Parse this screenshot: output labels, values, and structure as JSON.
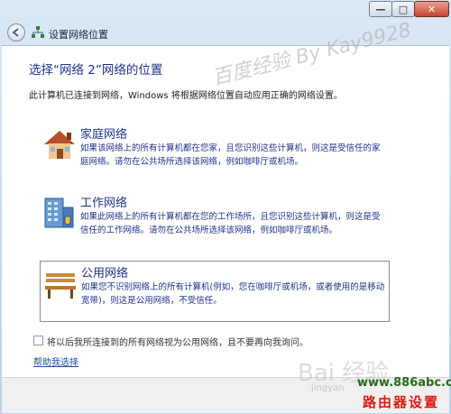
{
  "titlebar": {
    "minimize_glyph": "—",
    "maximize_glyph": "□",
    "close_glyph": "✕"
  },
  "nav": {
    "title": "设置网络位置",
    "back_icon": "back-arrow-icon",
    "network_icon": "network-icon"
  },
  "main": {
    "heading": "选择“网络 2”网络的位置",
    "description": "此计算机已连接到网络，Windows 将根据网络位置自动应用正确的网络设置。",
    "options": [
      {
        "title": "家庭网络",
        "description": "如果该网络上的所有计算机都在您家，且您识别这些计算机，则这是受信任的家庭网络。请勿在公共场所选择该网络，例如咖啡厅或机场。",
        "icon": "house-icon"
      },
      {
        "title": "工作网络",
        "description": "如果此网络上的所有计算机都在您的工作场所，且您识别这些计算机，则这是受信任的工作网络。请勿在公共场所选择该网络，例如咖啡厅或机场。",
        "icon": "office-building-icon"
      },
      {
        "title": "公用网络",
        "description": "如果您不识别网络上的所有计算机(例如，您在咖啡厅或机场，或者使用的是移动宽带)，则这是公用网络，不受信任。",
        "icon": "park-bench-icon"
      }
    ],
    "checkbox_label": "将以后我所连接到的所有网络视为公用网络，且不要再向我询问。",
    "help_link": "帮助我选择"
  },
  "watermarks": {
    "baidu_experience": "百度经验 By Kay9928",
    "baidu_logo": "Bai 经验",
    "baidu_url": "jingyan"
  },
  "site": {
    "url": "www.886abc.com",
    "name": "路由器设置"
  },
  "colors": {
    "heading_blue": "#1e3287",
    "link_blue": "#1c4fa0",
    "close_red": "#c9442f",
    "site_green": "#2a6a1c",
    "site_red": "#e0170f"
  }
}
